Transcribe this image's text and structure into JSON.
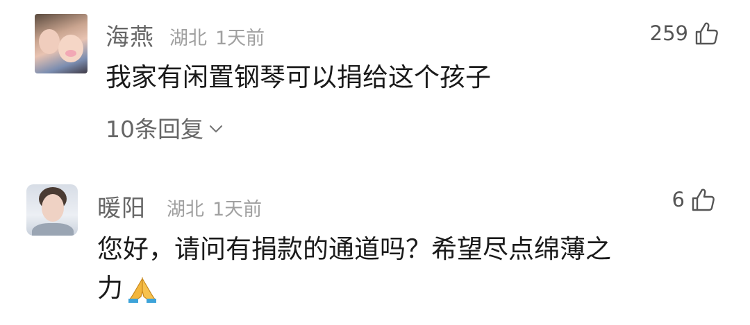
{
  "comments": [
    {
      "name": "海燕",
      "location": "湖北",
      "time": "1天前",
      "likes": "259",
      "text": "我家有闲置钢琴可以捐给这个孩子",
      "replies": "10条回复"
    },
    {
      "name": "暖阳",
      "location": "湖北",
      "time": "1天前",
      "likes": "6",
      "text_line1": "您好，请问有捐款的通道吗？希望尽点绵薄之",
      "text_line2": "力"
    }
  ],
  "icons": {
    "like": "thumbs-up-outline-icon",
    "chevron": "chevron-down-icon",
    "emoji": "folded-hands-emoji"
  },
  "colors": {
    "name": "#666666",
    "meta": "#a0a0a0",
    "text": "#1a1a1a",
    "emoji": "#f3b63c"
  }
}
